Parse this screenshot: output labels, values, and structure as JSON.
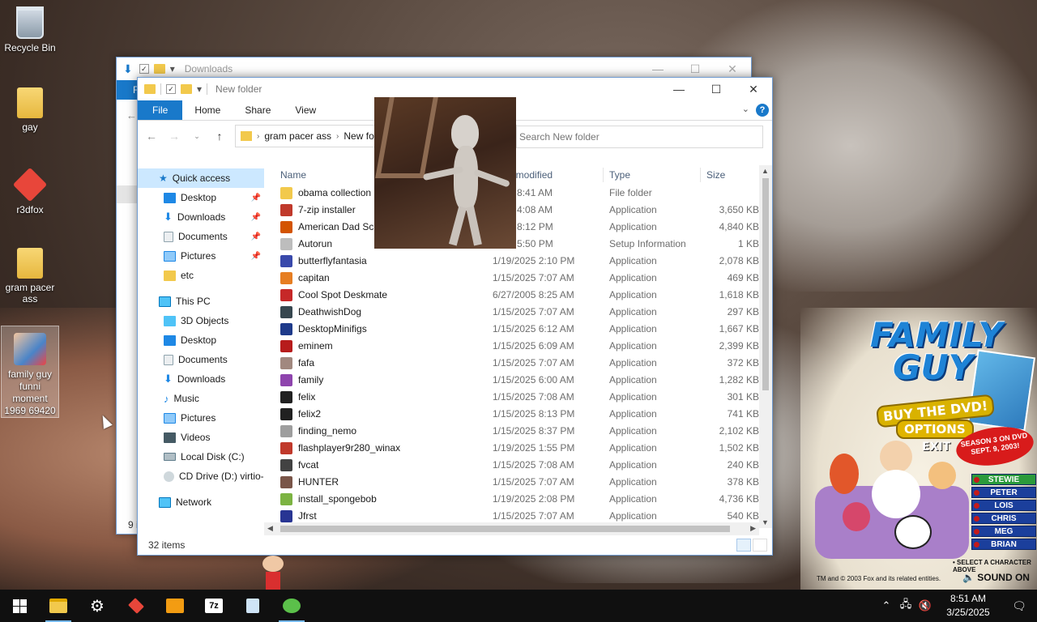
{
  "desktop": {
    "icons": [
      {
        "label": "Recycle Bin",
        "icon": "recycle-bin-icon"
      },
      {
        "label": "gay",
        "icon": "folder-icon"
      },
      {
        "label": "r3dfox",
        "icon": "r3dfox-icon"
      },
      {
        "label": "gram pacer ass",
        "icon": "folder-icon"
      },
      {
        "label": "family guy funni moment 1969 69420",
        "icon": "family-guy-icon"
      }
    ]
  },
  "back_window": {
    "title": "Downloads",
    "ribbon_tab": "F",
    "status": "9 i"
  },
  "explorer": {
    "title": "New folder",
    "ribbon": {
      "file": "File",
      "home": "Home",
      "share": "Share",
      "view": "View",
      "help": "?"
    },
    "address": {
      "crumbs": [
        "gram pacer ass",
        "New folder"
      ]
    },
    "search_placeholder": "Search New folder",
    "columns": {
      "name": "Name",
      "date": "Date modified",
      "type": "Type",
      "size": "Size"
    },
    "nav": {
      "quick_access": "Quick access",
      "quick_items": [
        "Desktop",
        "Downloads",
        "Documents",
        "Pictures",
        "etc"
      ],
      "this_pc": "This PC",
      "pc_items": [
        "3D Objects",
        "Desktop",
        "Documents",
        "Downloads",
        "Music",
        "Pictures",
        "Videos",
        "Local Disk (C:)",
        "CD Drive (D:) virtio-"
      ],
      "network": "Network"
    },
    "files": [
      {
        "name": "obama collection",
        "date": "2025 8:41 AM",
        "type": "File folder",
        "size": "",
        "color": "#f2c94c"
      },
      {
        "name": "7-zip installer",
        "date": "2025 4:08 AM",
        "type": "Application",
        "size": "3,650 KB",
        "color": "#c0392b"
      },
      {
        "name": "American Dad Scr",
        "date": "2025 8:12 PM",
        "type": "Application",
        "size": "4,840 KB",
        "color": "#d35400"
      },
      {
        "name": "Autorun",
        "date": "2025 5:50 PM",
        "type": "Setup Information",
        "size": "1 KB",
        "color": "#bdbdbd"
      },
      {
        "name": "butterflyfantasia",
        "date": "1/19/2025 2:10 PM",
        "type": "Application",
        "size": "2,078 KB",
        "color": "#3949ab"
      },
      {
        "name": "capitan",
        "date": "1/15/2025 7:07 AM",
        "type": "Application",
        "size": "469 KB",
        "color": "#e67e22"
      },
      {
        "name": "Cool Spot Deskmate",
        "date": "6/27/2005 8:25 AM",
        "type": "Application",
        "size": "1,618 KB",
        "color": "#c62828"
      },
      {
        "name": "DeathwishDog",
        "date": "1/15/2025 7:07 AM",
        "type": "Application",
        "size": "297 KB",
        "color": "#37474f"
      },
      {
        "name": "DesktopMinifigs",
        "date": "1/15/2025 6:12 AM",
        "type": "Application",
        "size": "1,667 KB",
        "color": "#1e3a8a"
      },
      {
        "name": "eminem",
        "date": "1/15/2025 6:09 AM",
        "type": "Application",
        "size": "2,399 KB",
        "color": "#b71c1c"
      },
      {
        "name": "fafa",
        "date": "1/15/2025 7:07 AM",
        "type": "Application",
        "size": "372 KB",
        "color": "#a1887f"
      },
      {
        "name": "family",
        "date": "1/15/2025 6:00 AM",
        "type": "Application",
        "size": "1,282 KB",
        "color": "#8e44ad"
      },
      {
        "name": "felix",
        "date": "1/15/2025 7:08 AM",
        "type": "Application",
        "size": "301 KB",
        "color": "#212121"
      },
      {
        "name": "felix2",
        "date": "1/15/2025 8:13 PM",
        "type": "Application",
        "size": "741 KB",
        "color": "#212121"
      },
      {
        "name": "finding_nemo",
        "date": "1/15/2025 8:37 PM",
        "type": "Application",
        "size": "2,102 KB",
        "color": "#9e9e9e"
      },
      {
        "name": "flashplayer9r280_winax",
        "date": "1/19/2025 1:55 PM",
        "type": "Application",
        "size": "1,502 KB",
        "color": "#c0392b"
      },
      {
        "name": "fvcat",
        "date": "1/15/2025 7:08 AM",
        "type": "Application",
        "size": "240 KB",
        "color": "#424242"
      },
      {
        "name": "HUNTER",
        "date": "1/15/2025 7:07 AM",
        "type": "Application",
        "size": "378 KB",
        "color": "#795548"
      },
      {
        "name": "install_spongebob",
        "date": "1/19/2025 2:08 PM",
        "type": "Application",
        "size": "4,736 KB",
        "color": "#7cb342"
      },
      {
        "name": "Jfrst",
        "date": "1/15/2025 7:07 AM",
        "type": "Application",
        "size": "540 KB",
        "color": "#283593"
      }
    ],
    "status": "32 items"
  },
  "promo": {
    "logo1": "FAMILY",
    "logo2": "GUY",
    "buy": "BUY THE DVD!",
    "options": "OPTIONS",
    "exit": "EXIT",
    "season": "SEASON 3 ON DVD SEPT. 9, 2003!",
    "characters": [
      "STEWIE",
      "PETER",
      "LOIS",
      "CHRIS",
      "MEG",
      "BRIAN"
    ],
    "select": "• SELECT A CHARACTER ABOVE",
    "tm": "TM and © 2003 Fox and its related entities.",
    "sound": "SOUND ON"
  },
  "taskbar": {
    "time": "8:51 AM",
    "date": "3/25/2025"
  }
}
